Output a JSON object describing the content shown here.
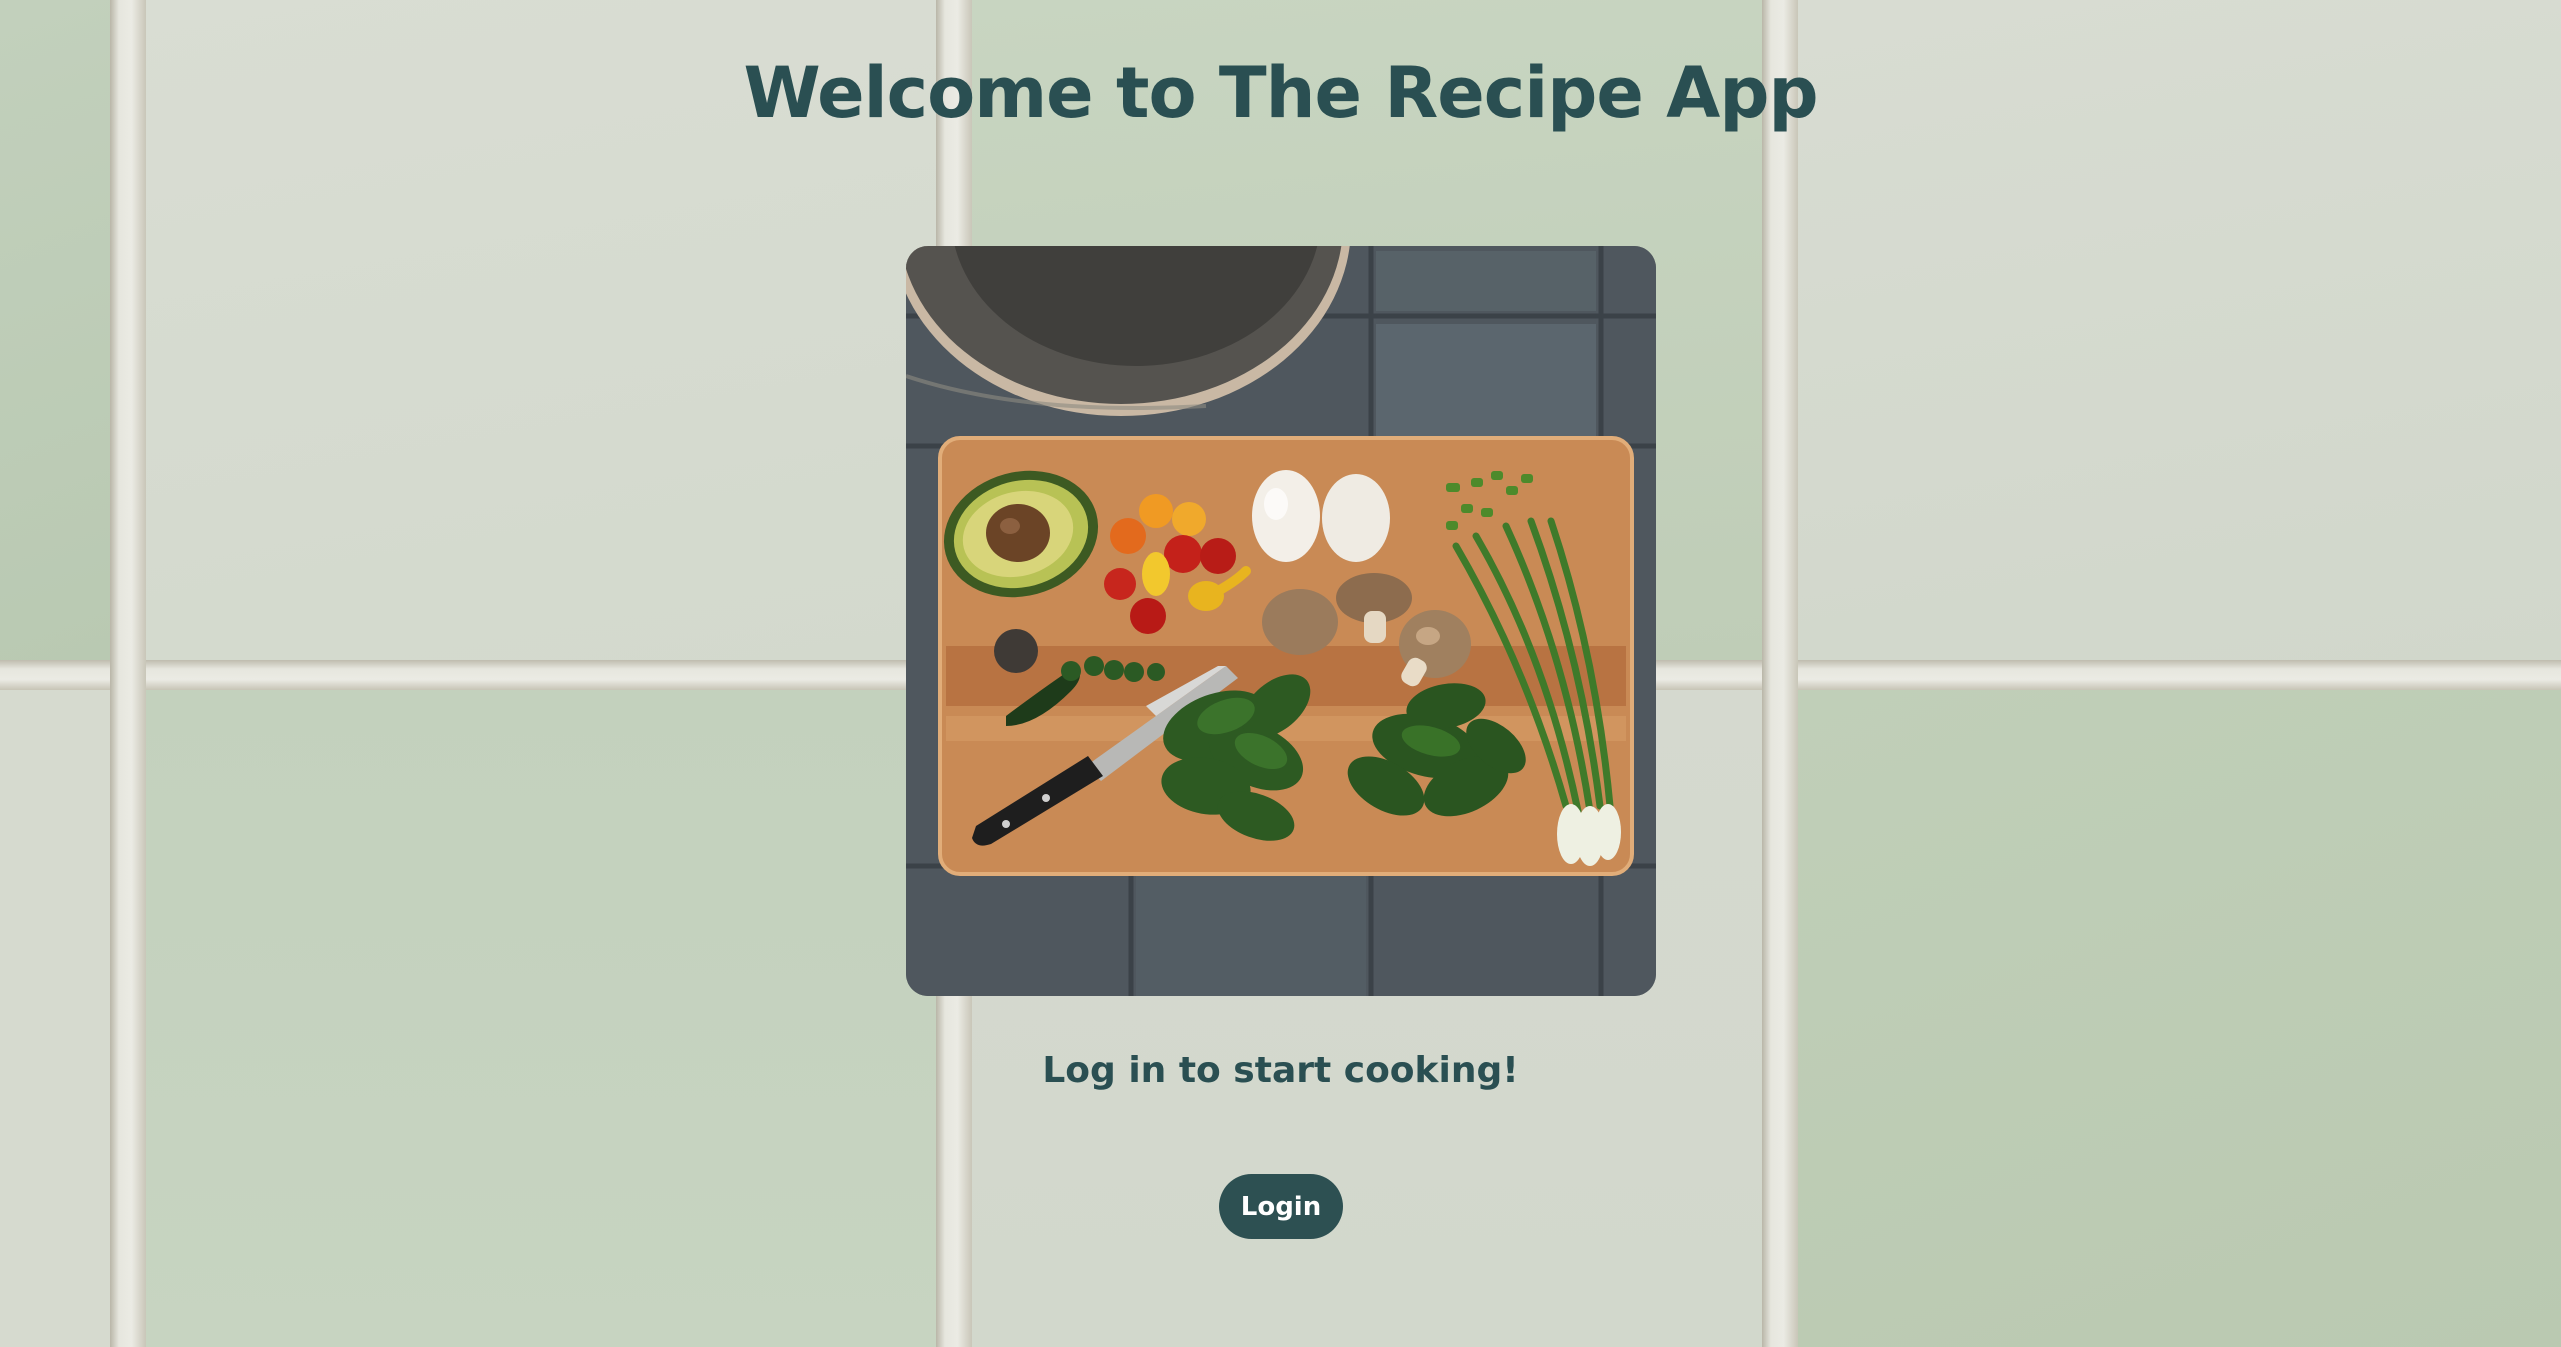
{
  "page": {
    "title": "Welcome to The Recipe App",
    "subtitle": "Log in to start cooking!",
    "login_label": "Login"
  },
  "hero_image": {
    "alt": "Cutting board with avocado, cherry tomatoes, eggs, mushrooms, spinach, green onions, jalapeño and a knife next to a frying pan"
  },
  "colors": {
    "primary": "#2a4f52",
    "button_bg": "#2d5052",
    "button_text": "#ffffff"
  }
}
